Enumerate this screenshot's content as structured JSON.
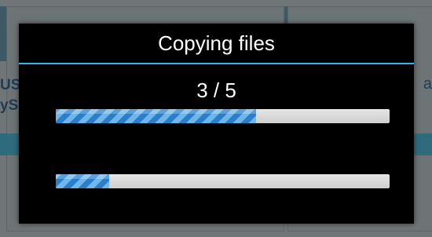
{
  "dialog": {
    "title": "Copying files",
    "counter": "3 / 5",
    "overall_progress": 0.6,
    "file_progress": 0.16
  },
  "background": {
    "text_left_line1": "US",
    "text_left_line2": "yS",
    "text_right": "a"
  },
  "colors": {
    "dialog_bg": "#000000",
    "accent": "#33b5e5",
    "progress_fill": "#2a7fcb",
    "progress_track": "#dcdcdc"
  }
}
